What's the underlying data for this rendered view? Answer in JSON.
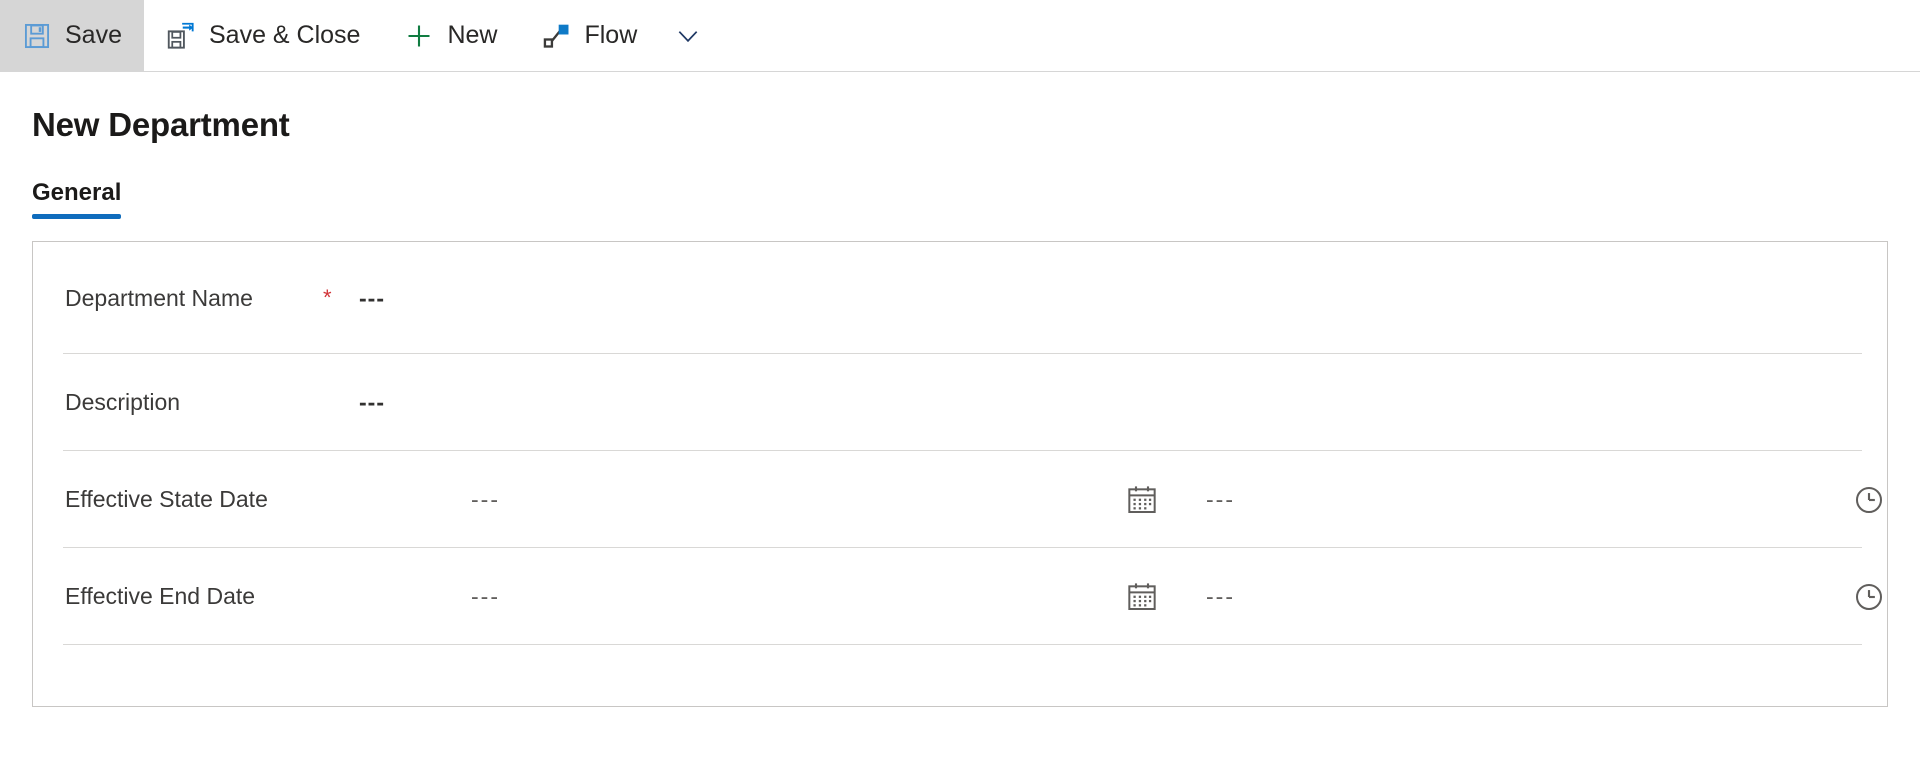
{
  "commandbar": {
    "buttons": [
      {
        "id": "save",
        "label": "Save",
        "icon": "save-icon",
        "selected": true
      },
      {
        "id": "save-close",
        "label": "Save & Close",
        "icon": "save-close-icon",
        "selected": false
      },
      {
        "id": "new",
        "label": "New",
        "icon": "plus-icon",
        "selected": false
      },
      {
        "id": "flow",
        "label": "Flow",
        "icon": "flow-icon",
        "selected": false
      }
    ],
    "overflow_icon": "chevron-down-icon"
  },
  "page": {
    "title": "New Department"
  },
  "tabs": [
    {
      "id": "general",
      "label": "General",
      "active": true
    }
  ],
  "form": {
    "rows": [
      {
        "id": "department-name",
        "label": "Department Name",
        "required": true,
        "required_marker": "*",
        "value": "---",
        "type": "text"
      },
      {
        "id": "description",
        "label": "Description",
        "required": false,
        "required_marker": "",
        "value": "---",
        "type": "text"
      },
      {
        "id": "effective-state-date",
        "label": "Effective State Date",
        "required": false,
        "required_marker": "",
        "value": "---",
        "time_value": "---",
        "date_icon": "calendar-icon",
        "time_icon": "clock-icon",
        "type": "datetime"
      },
      {
        "id": "effective-end-date",
        "label": "Effective End Date",
        "required": false,
        "required_marker": "",
        "value": "---",
        "time_value": "---",
        "date_icon": "calendar-icon",
        "time_icon": "clock-icon",
        "type": "datetime"
      }
    ]
  },
  "colors": {
    "accent": "#0f6cbd",
    "required": "#d13438",
    "icon_blue": "#0078d4",
    "icon_green": "#107c41",
    "selected_bg": "#d6d6d6",
    "border": "#c8c6c4",
    "divider": "#d9d8d6",
    "text": "#292827"
  }
}
